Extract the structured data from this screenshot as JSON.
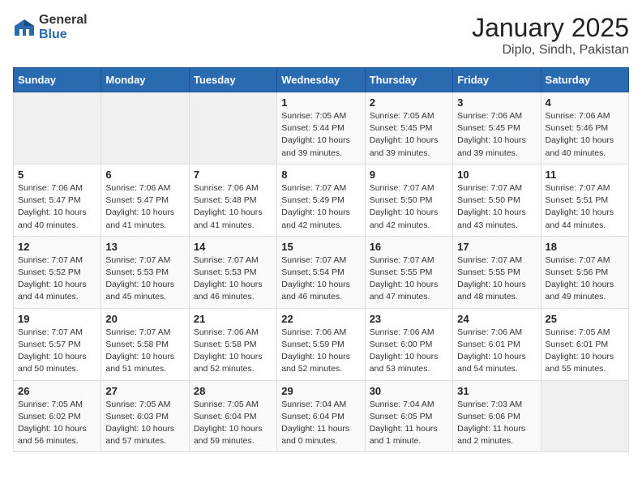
{
  "logo": {
    "general": "General",
    "blue": "Blue"
  },
  "title": "January 2025",
  "subtitle": "Diplo, Sindh, Pakistan",
  "days_of_week": [
    "Sunday",
    "Monday",
    "Tuesday",
    "Wednesday",
    "Thursday",
    "Friday",
    "Saturday"
  ],
  "weeks": [
    [
      {
        "day": "",
        "info": ""
      },
      {
        "day": "",
        "info": ""
      },
      {
        "day": "",
        "info": ""
      },
      {
        "day": "1",
        "info": "Sunrise: 7:05 AM\nSunset: 5:44 PM\nDaylight: 10 hours and 39 minutes."
      },
      {
        "day": "2",
        "info": "Sunrise: 7:05 AM\nSunset: 5:45 PM\nDaylight: 10 hours and 39 minutes."
      },
      {
        "day": "3",
        "info": "Sunrise: 7:06 AM\nSunset: 5:45 PM\nDaylight: 10 hours and 39 minutes."
      },
      {
        "day": "4",
        "info": "Sunrise: 7:06 AM\nSunset: 5:46 PM\nDaylight: 10 hours and 40 minutes."
      }
    ],
    [
      {
        "day": "5",
        "info": "Sunrise: 7:06 AM\nSunset: 5:47 PM\nDaylight: 10 hours and 40 minutes."
      },
      {
        "day": "6",
        "info": "Sunrise: 7:06 AM\nSunset: 5:47 PM\nDaylight: 10 hours and 41 minutes."
      },
      {
        "day": "7",
        "info": "Sunrise: 7:06 AM\nSunset: 5:48 PM\nDaylight: 10 hours and 41 minutes."
      },
      {
        "day": "8",
        "info": "Sunrise: 7:07 AM\nSunset: 5:49 PM\nDaylight: 10 hours and 42 minutes."
      },
      {
        "day": "9",
        "info": "Sunrise: 7:07 AM\nSunset: 5:50 PM\nDaylight: 10 hours and 42 minutes."
      },
      {
        "day": "10",
        "info": "Sunrise: 7:07 AM\nSunset: 5:50 PM\nDaylight: 10 hours and 43 minutes."
      },
      {
        "day": "11",
        "info": "Sunrise: 7:07 AM\nSunset: 5:51 PM\nDaylight: 10 hours and 44 minutes."
      }
    ],
    [
      {
        "day": "12",
        "info": "Sunrise: 7:07 AM\nSunset: 5:52 PM\nDaylight: 10 hours and 44 minutes."
      },
      {
        "day": "13",
        "info": "Sunrise: 7:07 AM\nSunset: 5:53 PM\nDaylight: 10 hours and 45 minutes."
      },
      {
        "day": "14",
        "info": "Sunrise: 7:07 AM\nSunset: 5:53 PM\nDaylight: 10 hours and 46 minutes."
      },
      {
        "day": "15",
        "info": "Sunrise: 7:07 AM\nSunset: 5:54 PM\nDaylight: 10 hours and 46 minutes."
      },
      {
        "day": "16",
        "info": "Sunrise: 7:07 AM\nSunset: 5:55 PM\nDaylight: 10 hours and 47 minutes."
      },
      {
        "day": "17",
        "info": "Sunrise: 7:07 AM\nSunset: 5:55 PM\nDaylight: 10 hours and 48 minutes."
      },
      {
        "day": "18",
        "info": "Sunrise: 7:07 AM\nSunset: 5:56 PM\nDaylight: 10 hours and 49 minutes."
      }
    ],
    [
      {
        "day": "19",
        "info": "Sunrise: 7:07 AM\nSunset: 5:57 PM\nDaylight: 10 hours and 50 minutes."
      },
      {
        "day": "20",
        "info": "Sunrise: 7:07 AM\nSunset: 5:58 PM\nDaylight: 10 hours and 51 minutes."
      },
      {
        "day": "21",
        "info": "Sunrise: 7:06 AM\nSunset: 5:58 PM\nDaylight: 10 hours and 52 minutes."
      },
      {
        "day": "22",
        "info": "Sunrise: 7:06 AM\nSunset: 5:59 PM\nDaylight: 10 hours and 52 minutes."
      },
      {
        "day": "23",
        "info": "Sunrise: 7:06 AM\nSunset: 6:00 PM\nDaylight: 10 hours and 53 minutes."
      },
      {
        "day": "24",
        "info": "Sunrise: 7:06 AM\nSunset: 6:01 PM\nDaylight: 10 hours and 54 minutes."
      },
      {
        "day": "25",
        "info": "Sunrise: 7:05 AM\nSunset: 6:01 PM\nDaylight: 10 hours and 55 minutes."
      }
    ],
    [
      {
        "day": "26",
        "info": "Sunrise: 7:05 AM\nSunset: 6:02 PM\nDaylight: 10 hours and 56 minutes."
      },
      {
        "day": "27",
        "info": "Sunrise: 7:05 AM\nSunset: 6:03 PM\nDaylight: 10 hours and 57 minutes."
      },
      {
        "day": "28",
        "info": "Sunrise: 7:05 AM\nSunset: 6:04 PM\nDaylight: 10 hours and 59 minutes."
      },
      {
        "day": "29",
        "info": "Sunrise: 7:04 AM\nSunset: 6:04 PM\nDaylight: 11 hours and 0 minutes."
      },
      {
        "day": "30",
        "info": "Sunrise: 7:04 AM\nSunset: 6:05 PM\nDaylight: 11 hours and 1 minute."
      },
      {
        "day": "31",
        "info": "Sunrise: 7:03 AM\nSunset: 6:06 PM\nDaylight: 11 hours and 2 minutes."
      },
      {
        "day": "",
        "info": ""
      }
    ]
  ]
}
